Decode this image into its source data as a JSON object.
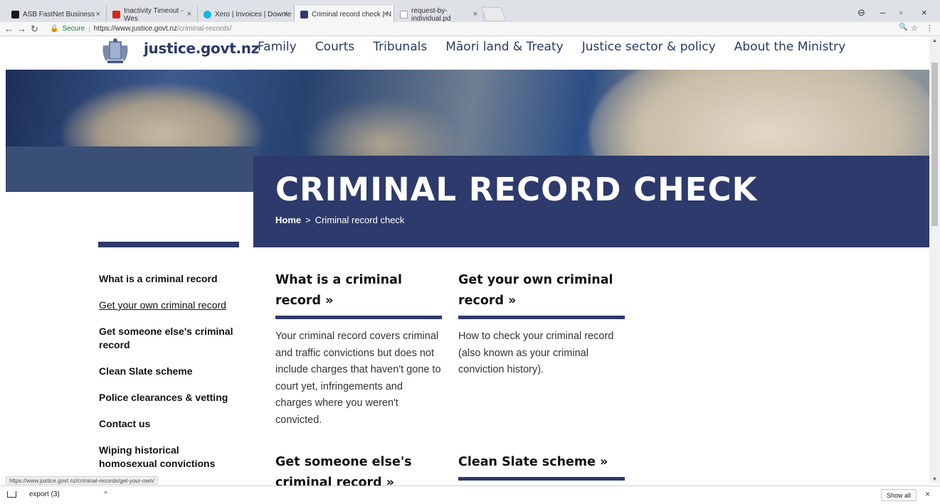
{
  "browser": {
    "tabs": [
      {
        "title": "ASB FastNet Business",
        "favcolor": "#1b1b1b"
      },
      {
        "title": "Inactivity Timeout - Wes",
        "favcolor": "#d52b1e"
      },
      {
        "title": "Xero | Invoices | Downie",
        "favcolor": "#13b5ea"
      },
      {
        "title": "Criminal record check | N",
        "favcolor": "#2d3a6b"
      },
      {
        "title": "request-by-individual.pd",
        "favcolor": "#9aa0a6"
      }
    ],
    "secure_label": "Secure",
    "url_host": "https://www.justice.govt.nz",
    "url_path": "/criminal-records/"
  },
  "site": {
    "brand": "justice.govt.nz",
    "nav": [
      "Family",
      "Courts",
      "Tribunals",
      "Māori land & Treaty",
      "Justice sector & policy",
      "About the Ministry"
    ]
  },
  "hero": {
    "title": "CRIMINAL RECORD CHECK",
    "crumb_home": "Home",
    "crumb_sep": ">",
    "crumb_current": "Criminal record check"
  },
  "sidebar": {
    "items": [
      "What is a criminal record",
      "Get your own criminal record",
      "Get someone else's criminal record",
      "Clean Slate scheme",
      "Police clearances & vetting",
      "Contact us",
      "Wiping historical homosexual convictions"
    ]
  },
  "cards": [
    {
      "title": "What is a criminal record »",
      "body": "Your criminal record covers criminal and traffic convictions but does not include charges that haven't gone to court yet, infringements and charges where you weren't convicted."
    },
    {
      "title": "Get your own criminal record »",
      "body": "How to check your criminal record (also known as your criminal conviction history)."
    },
    {
      "title": "Get someone else's criminal record »",
      "body": ""
    },
    {
      "title": "Clean Slate scheme »",
      "body": ""
    }
  ],
  "status_url": "https://www.justice.govt.nz/criminal-records/get-your-own/",
  "download": {
    "name": "export (3)",
    "show_all": "Show all"
  },
  "colors": {
    "navy": "#2d3a6b",
    "link": "#2b3a67"
  }
}
